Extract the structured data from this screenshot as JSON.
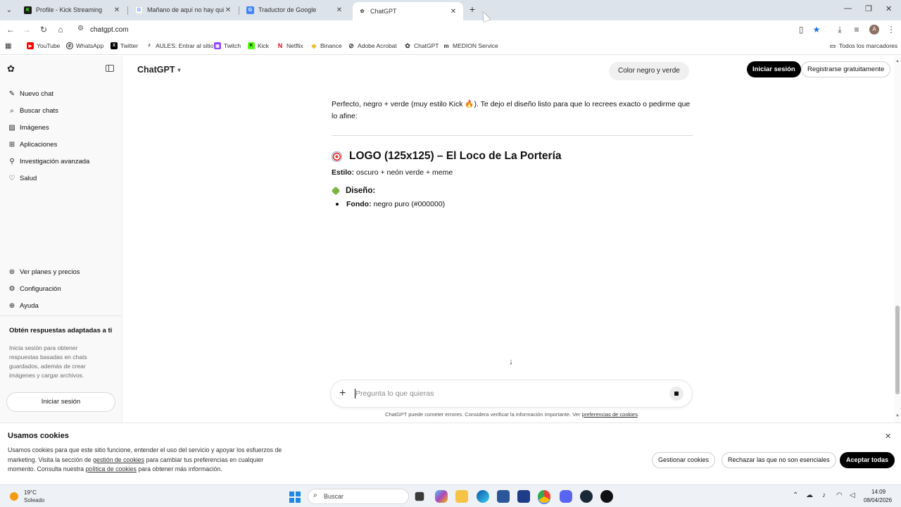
{
  "browser": {
    "tabs": [
      {
        "title": "Profile - Kick Streaming",
        "active": false
      },
      {
        "title": "Mañano de aquí no hay quien",
        "active": false
      },
      {
        "title": "Traductor de Google",
        "active": false
      },
      {
        "title": "ChatGPT",
        "active": true
      }
    ],
    "url": "chatgpt.com",
    "bookmarks": [
      {
        "label": "YouTube"
      },
      {
        "label": "WhatsApp"
      },
      {
        "label": "Twitter"
      },
      {
        "label": "AULES: Entrar al sitio"
      },
      {
        "label": "Twitch"
      },
      {
        "label": "Kick"
      },
      {
        "label": "Netflix"
      },
      {
        "label": "Binance"
      },
      {
        "label": "Adobe Acrobat"
      },
      {
        "label": "ChatGPT"
      },
      {
        "label": "MEDION Service"
      }
    ],
    "all_bookmarks": "Todos los marcadores",
    "avatar_letter": "A"
  },
  "sidebar": {
    "items": [
      {
        "label": "Nuevo chat",
        "icon": "edit-icon"
      },
      {
        "label": "Buscar chats",
        "icon": "search-icon"
      },
      {
        "label": "Imágenes",
        "icon": "image-icon"
      },
      {
        "label": "Aplicaciones",
        "icon": "apps-icon"
      },
      {
        "label": "Investigación avanzada",
        "icon": "research-icon"
      },
      {
        "label": "Salud",
        "icon": "heart-icon"
      }
    ],
    "bottom_items": [
      {
        "label": "Ver planes y precios",
        "icon": "plans-icon"
      },
      {
        "label": "Configuración",
        "icon": "gear-icon"
      },
      {
        "label": "Ayuda",
        "icon": "help-icon"
      }
    ],
    "cta_title": "Obtén respuestas adaptadas a ti",
    "cta_desc": "Inicia sesión para obtener respuestas basadas en chats guardados, además de crear imágenes y cargar archivos.",
    "login_label": "Iniciar sesión"
  },
  "header": {
    "model": "ChatGPT",
    "chip": "Color negro y verde",
    "login": "Iniciar sesión",
    "register": "Registrarse gratuitamente"
  },
  "chat": {
    "intro": "Perfecto, negro + verde (muy estilo Kick 🔥). Te dejo el diseño listo para que lo recrees exacto o pedirme que lo afine:",
    "heading": "LOGO (125x125) – El Loco de La Portería",
    "style_label": "Estilo:",
    "style_value": "oscuro + neón verde + meme",
    "design_heading": "Diseño:",
    "bullet_label": "Fondo:",
    "bullet_value": "negro puro (#000000)"
  },
  "composer": {
    "placeholder": "Pregunta lo que quieras"
  },
  "disclaimer": {
    "text": "ChatGPT puede cometer errores. Considera verificar la información importante. Ver",
    "link": "preferencias de cookies",
    "end": "."
  },
  "cookies": {
    "title": "Usamos cookies",
    "text_1": "Usamos cookies para que este sitio funcione, entender el uso del servicio y apoyar los esfuerzos de marketing. Visita la sección de",
    "link_1": "gestión de cookies",
    "text_2": "para cambiar tus preferencias en cualquier momento. Consulta nuestra",
    "link_2": "política de cookies",
    "text_3": "para obtener más información.",
    "manage": "Gestionar cookies",
    "reject": "Rechazar las que no son esenciales",
    "accept": "Aceptar todas"
  },
  "taskbar": {
    "temp": "19°C",
    "weather": "Soleado",
    "search": "Buscar",
    "time": "14:09",
    "date": "08/04/2026"
  }
}
